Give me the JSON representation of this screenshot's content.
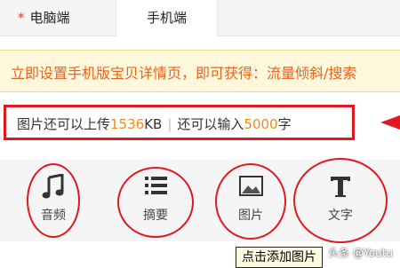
{
  "tabs": {
    "desktop": {
      "label": "电脑端",
      "required_mark": "*"
    },
    "mobile": {
      "label": "手机端"
    }
  },
  "promo": {
    "text": "立即设置手机版宝贝详情页，即可获得：流量倾斜/搜索"
  },
  "upload_info": {
    "prefix": "图片还可以上传",
    "image_quota": "1536",
    "image_unit": "KB",
    "separator": "|",
    "text_prefix": "还可以输入",
    "text_quota": "5000",
    "text_unit": "字"
  },
  "toolbar": {
    "audio": {
      "label": "音频",
      "icon": "music-note-icon"
    },
    "summary": {
      "label": "摘要",
      "icon": "list-icon"
    },
    "image": {
      "label": "图片",
      "icon": "image-icon"
    },
    "text": {
      "label": "文字",
      "icon": "text-t-icon"
    }
  },
  "tooltip": {
    "text": "点击添加图片"
  },
  "watermark": {
    "text": "头条 @Youtu"
  },
  "colors": {
    "highlight_red": "#e0191e",
    "quota_orange": "#f08c1a",
    "promo_orange": "#e8641b",
    "promo_bg": "#fff8dc"
  }
}
